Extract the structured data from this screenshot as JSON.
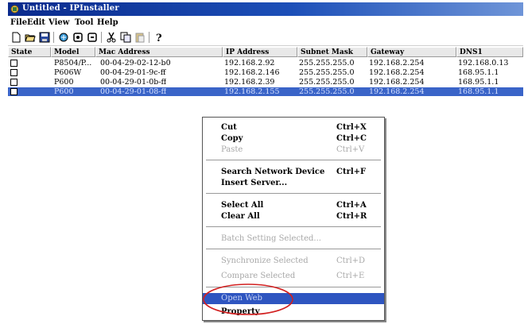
{
  "window": {
    "title": "Untitled - IPInstaller"
  },
  "menu": [
    "File",
    "Edit",
    "View",
    "Tool",
    "Help"
  ],
  "toolbar_icons": [
    "new-icon",
    "open-icon",
    "save-icon",
    "search-network-icon",
    "copy-config-icon",
    "paste-config-icon",
    "cut-icon",
    "copy-icon",
    "paste-icon",
    "help-icon"
  ],
  "table": {
    "columns": [
      "State",
      "Model",
      "Mac Address",
      "IP Address",
      "Subnet Mask",
      "Gateway",
      "DNS1"
    ],
    "rows": [
      [
        "",
        "P8504/P...",
        "00-04-29-02-12-b0",
        "192.168.2.92",
        "255.255.255.0",
        "192.168.2.254",
        "192.168.0.13"
      ],
      [
        "",
        "P606W",
        "00-04-29-01-9c-ff",
        "192.168.2.146",
        "255.255.255.0",
        "192.168.2.254",
        "168.95.1.1"
      ],
      [
        "",
        "P600",
        "00-04-29-01-0b-ff",
        "192.168.2.39",
        "255.255.255.0",
        "192.168.2.254",
        "168.95.1.1"
      ],
      [
        "",
        "P600",
        "00-04-29-01-08-ff",
        "192.168.2.155",
        "255.255.255.0",
        "192.168.2.254",
        "168.95.1.1"
      ]
    ],
    "selected_row": 3
  },
  "context_menu": {
    "items": [
      {
        "label": "Cut",
        "shortcut": "Ctrl+X",
        "disabled": false
      },
      {
        "label": "Copy",
        "shortcut": "Ctrl+C",
        "disabled": false
      },
      {
        "label": "Paste",
        "shortcut": "Ctrl+V",
        "disabled": true
      },
      {
        "label": "Search Network Device",
        "shortcut": "Ctrl+F",
        "disabled": false
      },
      {
        "label": "Insert Server...",
        "shortcut": "",
        "disabled": false
      },
      {
        "label": "Select All",
        "shortcut": "Ctrl+A",
        "disabled": false
      },
      {
        "label": "Clear All",
        "shortcut": "Ctrl+R",
        "disabled": false
      },
      {
        "label": "Batch Setting Selected...",
        "shortcut": "",
        "disabled": true
      },
      {
        "label": "Synchronize Selected",
        "shortcut": "Ctrl+D",
        "disabled": true
      },
      {
        "label": "Compare Selected",
        "shortcut": "Ctrl+E",
        "disabled": true
      },
      {
        "label": "Open Web",
        "shortcut": "",
        "disabled": false,
        "highlighted": true
      },
      {
        "label": "Property",
        "shortcut": "",
        "disabled": false
      }
    ]
  },
  "colors": {
    "title_bar": "#0a2a8c",
    "selection": "#3a64c8",
    "annotation": "#d22020"
  }
}
